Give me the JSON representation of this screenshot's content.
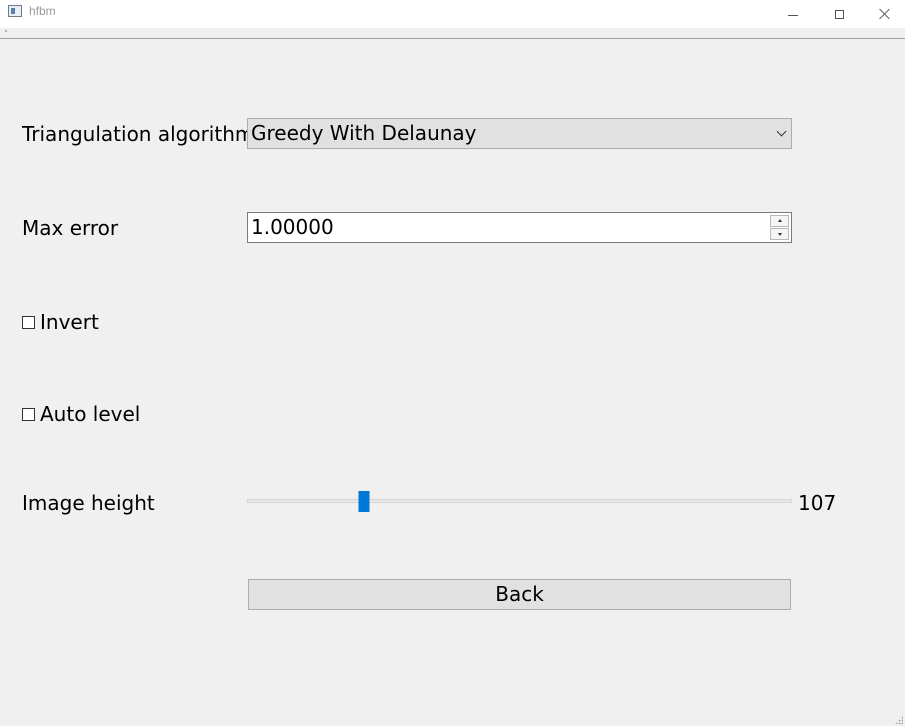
{
  "window": {
    "title": "hfbm",
    "controls": [
      "minimize",
      "maximize",
      "close"
    ]
  },
  "form": {
    "triangulation": {
      "label": "Triangulation algorithm",
      "selected": "Greedy With Delaunay"
    },
    "max_error": {
      "label": "Max error",
      "value": "1.00000"
    },
    "invert": {
      "label": "Invert",
      "checked": false
    },
    "auto_level": {
      "label": "Auto level",
      "checked": false
    },
    "image_height": {
      "label": "Image height",
      "value": "107",
      "position_fraction": 0.214
    },
    "back_button": {
      "label": "Back"
    }
  },
  "icons": {
    "app": "app-window-icon",
    "combo": "chevron-down-icon",
    "spin_up": "spin-up-icon",
    "spin_down": "spin-down-icon"
  },
  "colors": {
    "accent": "#0078d7",
    "background": "#f0f0f0",
    "button": "#e1e1e1"
  }
}
